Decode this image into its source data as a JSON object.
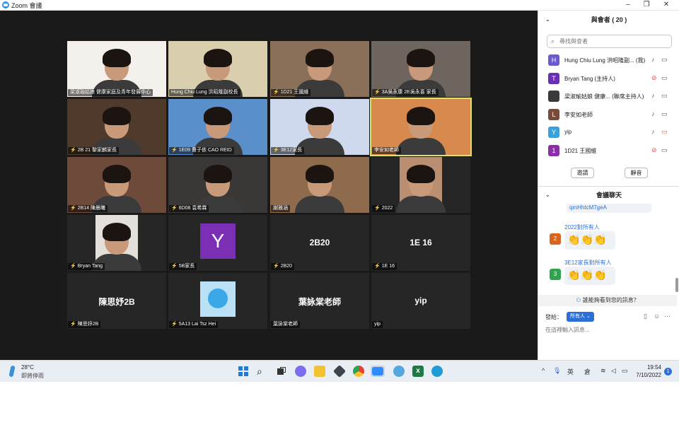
{
  "window": {
    "title": "Zoom 會議",
    "minimize": "–",
    "maximize": "❐",
    "close": "✕"
  },
  "video_tiles": [
    {
      "name": "梁淑瑜姑娘 健康家庭及青年發展中心",
      "muted": false,
      "kind": "photo",
      "bg": "#f4f1ec"
    },
    {
      "name": "Hung Chiu Lung 洪昭隆副校長",
      "muted": false,
      "kind": "photo",
      "bg": "#d9cfae"
    },
    {
      "name": "1D21 王國維",
      "muted": true,
      "kind": "photo",
      "bg": "#8a7058"
    },
    {
      "name": "3A吳永康  2E吳永喜 家長",
      "muted": true,
      "kind": "photo",
      "bg": "#6e655e"
    },
    {
      "name": "2B 21 黎家麟家長",
      "muted": true,
      "kind": "photo",
      "bg": "#4f3a2b"
    },
    {
      "name": "1E09 曹子依 CAO REID",
      "muted": true,
      "kind": "photo",
      "bg": "#5a8fc9"
    },
    {
      "name": "3E12家長",
      "muted": true,
      "kind": "photo",
      "bg": "#cfd9ee"
    },
    {
      "name": "李安如老師",
      "muted": false,
      "kind": "photo",
      "bg": "#d88a4e",
      "active": true
    },
    {
      "name": "2B14 陳晨曦",
      "muted": true,
      "kind": "photo",
      "bg": "#6d4a3a"
    },
    {
      "name": "6D08 袁希霖",
      "muted": true,
      "kind": "photo",
      "bg": "#3a3837"
    },
    {
      "name": "謝雅涵",
      "muted": false,
      "kind": "photo",
      "bg": "#8e6b4d"
    },
    {
      "name": "2022",
      "muted": true,
      "kind": "photo-small",
      "bg": "#b98e71"
    },
    {
      "name": "Bryan Tang",
      "muted": true,
      "kind": "photo-small",
      "bg": "#e3dfda"
    },
    {
      "name": "5B家長",
      "muted": true,
      "kind": "avatar",
      "letter": "Y"
    },
    {
      "name": "2B20",
      "muted": true,
      "kind": "text",
      "display": "2B20"
    },
    {
      "name": "1E 16",
      "muted": true,
      "kind": "text",
      "display": "1E 16"
    },
    {
      "name": "陳思妤2B",
      "muted": true,
      "kind": "text",
      "display": "陳思妤2B"
    },
    {
      "name": "5A13 Lai Tsz Hei",
      "muted": true,
      "kind": "bird"
    },
    {
      "name": "葉詠棠老師",
      "muted": false,
      "kind": "text",
      "display": "葉詠棠老師"
    },
    {
      "name": "yip",
      "muted": false,
      "kind": "text",
      "display": "yip"
    }
  ],
  "participants_panel": {
    "title": "與會者 ( 20 )",
    "search_placeholder": "尋找與會者",
    "participants": [
      {
        "initial": "H",
        "color": "#6a5acd",
        "name": "Hung Chiu Lung 洪昭隆副...  (我)",
        "mic": "on",
        "cam": "on"
      },
      {
        "initial": "T",
        "color": "#6b2fb3",
        "name": "Bryan Tang (主持人)",
        "mic": "muted",
        "cam": "on"
      },
      {
        "initial": "",
        "color": "#3a3a3a",
        "name": "梁淑瑜姑娘 健康...  (聯席主持人)",
        "mic": "on",
        "cam": "on"
      },
      {
        "initial": "L",
        "color": "#7a4a3a",
        "name": "李安如老師",
        "mic": "on",
        "cam": "on"
      },
      {
        "initial": "Y",
        "color": "#3aa0d8",
        "name": "yip",
        "mic": "on",
        "cam": "off"
      },
      {
        "initial": "1",
        "color": "#8a2fa8",
        "name": "1D21 王國維",
        "mic": "muted",
        "cam": "on"
      }
    ],
    "invite_label": "邀請",
    "mute_label": "靜音"
  },
  "chat_panel": {
    "title": "會議聊天",
    "prev_fragment": "qmHhtcM7geA",
    "messages": [
      {
        "avatar": "2",
        "color": "#d8641e",
        "sender": "2022對所有人",
        "content": "👏👏👏"
      },
      {
        "avatar": "3",
        "color": "#2fa34e",
        "sender": "3E12家長對所有人",
        "content": "👏👏👏"
      }
    ],
    "who_can_see": "誰能夠看到您的訊息？",
    "send_to_label": "發給：",
    "send_to_value": "所有人 ⌄",
    "input_placeholder": "在這裡輸入訊息..."
  },
  "taskbar": {
    "temperature": "28°C",
    "weather": "即將停雨",
    "input_method": "英",
    "ime": "倉",
    "time": "19:54",
    "date": "7/10/2022",
    "notifications": "1"
  },
  "colors": {
    "zoom_blue": "#2d8cff",
    "video_bg": "#1a1a1a",
    "active_speaker": "#d8e36a",
    "muted_red": "#e34c4c"
  }
}
